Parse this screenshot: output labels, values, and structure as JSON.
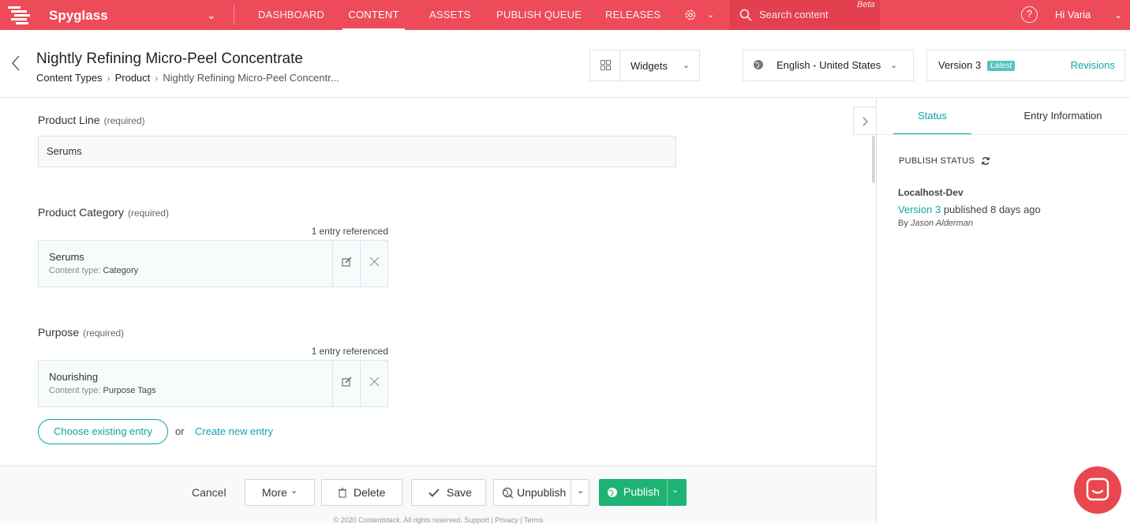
{
  "colors": {
    "brand": "#ed4b5a",
    "accent": "#0da4a8",
    "publish": "#1eb373"
  },
  "topbar": {
    "stack_name": "Spyglass",
    "nav": [
      "DASHBOARD",
      "CONTENT",
      "ASSETS",
      "PUBLISH QUEUE",
      "RELEASES"
    ],
    "active_nav": "CONTENT",
    "search_placeholder": "Search content",
    "beta": "Beta",
    "help": "?",
    "greeting": "Hi  Varia"
  },
  "header": {
    "title": "Nightly Refining Micro-Peel Concentrate",
    "breadcrumbs": [
      "Content Types",
      "Product",
      "Nightly Refining Micro-Peel Concentr..."
    ],
    "widgets_label": "Widgets",
    "locale": "English - United States",
    "version": "Version 3",
    "latest_badge": "Latest",
    "revisions": "Revisions"
  },
  "form": {
    "product_line": {
      "label": "Product Line",
      "required": "(required)",
      "value": "Serums"
    },
    "product_category": {
      "label": "Product Category",
      "required": "(required)",
      "ref_count": "1 entry referenced",
      "entry_title": "Serums",
      "content_type_prefix": "Content type:",
      "content_type": "Category"
    },
    "purpose": {
      "label": "Purpose",
      "required": "(required)",
      "ref_count": "1 entry referenced",
      "entry_title": "Nourishing",
      "content_type_prefix": "Content type:",
      "content_type": "Purpose Tags"
    },
    "choose_existing": "Choose existing entry",
    "or": "or",
    "create_new": "Create new entry"
  },
  "footer": {
    "cancel": "Cancel",
    "more": "More",
    "delete": "Delete",
    "save": "Save",
    "unpublish": "Unpublish",
    "publish": "Publish",
    "copyright": "© 2020 Contentstack. All rights reserved. Support | Privacy | Terms"
  },
  "sidebar": {
    "tabs": [
      "Status",
      "Entry Information"
    ],
    "active_tab": "Status",
    "publish_status_heading": "PUBLISH STATUS",
    "environment": "Localhost-Dev",
    "published_version": "Version 3",
    "published_text": "published 8 days ago",
    "by_prefix": "By",
    "by_user": "Jason Alderman"
  }
}
